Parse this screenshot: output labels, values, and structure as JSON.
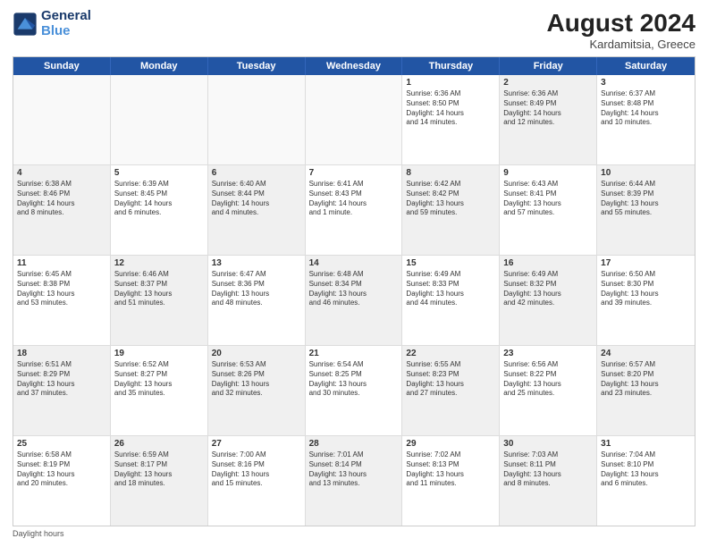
{
  "header": {
    "logo_line1": "General",
    "logo_line2": "Blue",
    "main_title": "August 2024",
    "sub_title": "Kardamitsia, Greece"
  },
  "days_of_week": [
    "Sunday",
    "Monday",
    "Tuesday",
    "Wednesday",
    "Thursday",
    "Friday",
    "Saturday"
  ],
  "weeks": [
    [
      {
        "day": "",
        "info": "",
        "shaded": false,
        "empty": true
      },
      {
        "day": "",
        "info": "",
        "shaded": false,
        "empty": true
      },
      {
        "day": "",
        "info": "",
        "shaded": false,
        "empty": true
      },
      {
        "day": "",
        "info": "",
        "shaded": false,
        "empty": true
      },
      {
        "day": "1",
        "info": "Sunrise: 6:36 AM\nSunset: 8:50 PM\nDaylight: 14 hours\nand 14 minutes.",
        "shaded": false,
        "empty": false
      },
      {
        "day": "2",
        "info": "Sunrise: 6:36 AM\nSunset: 8:49 PM\nDaylight: 14 hours\nand 12 minutes.",
        "shaded": true,
        "empty": false
      },
      {
        "day": "3",
        "info": "Sunrise: 6:37 AM\nSunset: 8:48 PM\nDaylight: 14 hours\nand 10 minutes.",
        "shaded": false,
        "empty": false
      }
    ],
    [
      {
        "day": "4",
        "info": "Sunrise: 6:38 AM\nSunset: 8:46 PM\nDaylight: 14 hours\nand 8 minutes.",
        "shaded": true,
        "empty": false
      },
      {
        "day": "5",
        "info": "Sunrise: 6:39 AM\nSunset: 8:45 PM\nDaylight: 14 hours\nand 6 minutes.",
        "shaded": false,
        "empty": false
      },
      {
        "day": "6",
        "info": "Sunrise: 6:40 AM\nSunset: 8:44 PM\nDaylight: 14 hours\nand 4 minutes.",
        "shaded": true,
        "empty": false
      },
      {
        "day": "7",
        "info": "Sunrise: 6:41 AM\nSunset: 8:43 PM\nDaylight: 14 hours\nand 1 minute.",
        "shaded": false,
        "empty": false
      },
      {
        "day": "8",
        "info": "Sunrise: 6:42 AM\nSunset: 8:42 PM\nDaylight: 13 hours\nand 59 minutes.",
        "shaded": true,
        "empty": false
      },
      {
        "day": "9",
        "info": "Sunrise: 6:43 AM\nSunset: 8:41 PM\nDaylight: 13 hours\nand 57 minutes.",
        "shaded": false,
        "empty": false
      },
      {
        "day": "10",
        "info": "Sunrise: 6:44 AM\nSunset: 8:39 PM\nDaylight: 13 hours\nand 55 minutes.",
        "shaded": true,
        "empty": false
      }
    ],
    [
      {
        "day": "11",
        "info": "Sunrise: 6:45 AM\nSunset: 8:38 PM\nDaylight: 13 hours\nand 53 minutes.",
        "shaded": false,
        "empty": false
      },
      {
        "day": "12",
        "info": "Sunrise: 6:46 AM\nSunset: 8:37 PM\nDaylight: 13 hours\nand 51 minutes.",
        "shaded": true,
        "empty": false
      },
      {
        "day": "13",
        "info": "Sunrise: 6:47 AM\nSunset: 8:36 PM\nDaylight: 13 hours\nand 48 minutes.",
        "shaded": false,
        "empty": false
      },
      {
        "day": "14",
        "info": "Sunrise: 6:48 AM\nSunset: 8:34 PM\nDaylight: 13 hours\nand 46 minutes.",
        "shaded": true,
        "empty": false
      },
      {
        "day": "15",
        "info": "Sunrise: 6:49 AM\nSunset: 8:33 PM\nDaylight: 13 hours\nand 44 minutes.",
        "shaded": false,
        "empty": false
      },
      {
        "day": "16",
        "info": "Sunrise: 6:49 AM\nSunset: 8:32 PM\nDaylight: 13 hours\nand 42 minutes.",
        "shaded": true,
        "empty": false
      },
      {
        "day": "17",
        "info": "Sunrise: 6:50 AM\nSunset: 8:30 PM\nDaylight: 13 hours\nand 39 minutes.",
        "shaded": false,
        "empty": false
      }
    ],
    [
      {
        "day": "18",
        "info": "Sunrise: 6:51 AM\nSunset: 8:29 PM\nDaylight: 13 hours\nand 37 minutes.",
        "shaded": true,
        "empty": false
      },
      {
        "day": "19",
        "info": "Sunrise: 6:52 AM\nSunset: 8:27 PM\nDaylight: 13 hours\nand 35 minutes.",
        "shaded": false,
        "empty": false
      },
      {
        "day": "20",
        "info": "Sunrise: 6:53 AM\nSunset: 8:26 PM\nDaylight: 13 hours\nand 32 minutes.",
        "shaded": true,
        "empty": false
      },
      {
        "day": "21",
        "info": "Sunrise: 6:54 AM\nSunset: 8:25 PM\nDaylight: 13 hours\nand 30 minutes.",
        "shaded": false,
        "empty": false
      },
      {
        "day": "22",
        "info": "Sunrise: 6:55 AM\nSunset: 8:23 PM\nDaylight: 13 hours\nand 27 minutes.",
        "shaded": true,
        "empty": false
      },
      {
        "day": "23",
        "info": "Sunrise: 6:56 AM\nSunset: 8:22 PM\nDaylight: 13 hours\nand 25 minutes.",
        "shaded": false,
        "empty": false
      },
      {
        "day": "24",
        "info": "Sunrise: 6:57 AM\nSunset: 8:20 PM\nDaylight: 13 hours\nand 23 minutes.",
        "shaded": true,
        "empty": false
      }
    ],
    [
      {
        "day": "25",
        "info": "Sunrise: 6:58 AM\nSunset: 8:19 PM\nDaylight: 13 hours\nand 20 minutes.",
        "shaded": false,
        "empty": false
      },
      {
        "day": "26",
        "info": "Sunrise: 6:59 AM\nSunset: 8:17 PM\nDaylight: 13 hours\nand 18 minutes.",
        "shaded": true,
        "empty": false
      },
      {
        "day": "27",
        "info": "Sunrise: 7:00 AM\nSunset: 8:16 PM\nDaylight: 13 hours\nand 15 minutes.",
        "shaded": false,
        "empty": false
      },
      {
        "day": "28",
        "info": "Sunrise: 7:01 AM\nSunset: 8:14 PM\nDaylight: 13 hours\nand 13 minutes.",
        "shaded": true,
        "empty": false
      },
      {
        "day": "29",
        "info": "Sunrise: 7:02 AM\nSunset: 8:13 PM\nDaylight: 13 hours\nand 11 minutes.",
        "shaded": false,
        "empty": false
      },
      {
        "day": "30",
        "info": "Sunrise: 7:03 AM\nSunset: 8:11 PM\nDaylight: 13 hours\nand 8 minutes.",
        "shaded": true,
        "empty": false
      },
      {
        "day": "31",
        "info": "Sunrise: 7:04 AM\nSunset: 8:10 PM\nDaylight: 13 hours\nand 6 minutes.",
        "shaded": false,
        "empty": false
      }
    ]
  ],
  "footer": "Daylight hours"
}
